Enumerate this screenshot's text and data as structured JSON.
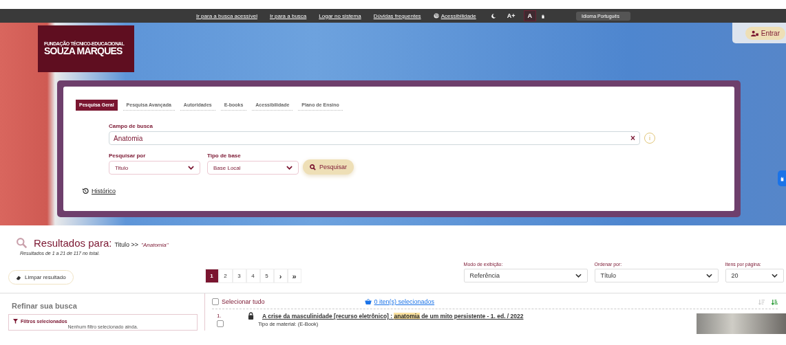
{
  "top_bar": {
    "links": [
      {
        "label": "Ir para a busca acessível",
        "kind": "text"
      },
      {
        "label": "Ir para a busca",
        "kind": "text"
      },
      {
        "label": "Logar no sistema",
        "kind": "text"
      },
      {
        "label": "Dúvidas frequentes",
        "kind": "text"
      },
      {
        "label": "Acessibilidade",
        "kind": "globe"
      }
    ],
    "contrast_buttons": [
      {
        "label": "A+",
        "selected": false
      },
      {
        "label": "A",
        "selected": true
      }
    ],
    "language": "Idioma Português"
  },
  "logo": {
    "line_1": "FUNDAÇÃO TÉCNICO-EDUCACIONAL",
    "line_2": "SOUZA MARQUES"
  },
  "login_button": "Entrar",
  "search_panel": {
    "tabs": [
      {
        "label": "Pesquisa Geral",
        "selected": true
      },
      {
        "label": "Pesquisa Avançada",
        "selected": false
      },
      {
        "label": "Autoridades",
        "selected": false
      },
      {
        "label": "E-books",
        "selected": false
      },
      {
        "label": "Acessibilidade",
        "selected": false
      },
      {
        "label": "Plano de Ensino",
        "selected": false
      }
    ],
    "search_field": {
      "label": "Campo de busca",
      "value": "Anatomia",
      "clear": "×",
      "info": "i"
    },
    "selects": [
      {
        "label": "Pesquisar por",
        "value": "Titulo"
      },
      {
        "label": "Tipo de base",
        "value": "Base Local"
      }
    ],
    "search_button": "Pesquisar",
    "history_link": "Histórico"
  },
  "results": {
    "heading": "Resultados para:",
    "field": "Titulo >>",
    "query": "\"Anatomia\"",
    "summary": "Resultados de 1 a 21 de 117 no total.",
    "clear_button": "Limpar resultado",
    "pagination": {
      "pages": [
        {
          "label": "1",
          "selected": true
        },
        {
          "label": "2",
          "selected": false
        },
        {
          "label": "3",
          "selected": false
        },
        {
          "label": "4",
          "selected": false
        },
        {
          "label": "5",
          "selected": false
        }
      ],
      "next": "›",
      "last": "»"
    },
    "options": [
      {
        "label": "Modo de exibição:",
        "value": "Referência",
        "kind": "wide"
      },
      {
        "label": "Ordenar por:",
        "value": "Título",
        "kind": "wide"
      },
      {
        "label": "Itens por página:",
        "value": "20",
        "kind": "narrow"
      }
    ]
  },
  "sidebar": {
    "title": "Refinar sua busca",
    "filters_title": "Filtros selecionados",
    "filters_empty": "Nenhum filtro selecionado ainda."
  },
  "list": {
    "select_all": {
      "label": "Selecionar tudo",
      "checked": false
    },
    "selected_count": "0 iten(s) selecionados",
    "items": [
      {
        "number": "1.",
        "checked": false,
        "title_before": "A crise da masculinidade [recurso eletrônico] :",
        "highlight": "anatomia",
        "title_after": "de um mito persistente - 1. ed. / 2022",
        "material": "Tipo de material: (E-Book)"
      }
    ]
  }
}
